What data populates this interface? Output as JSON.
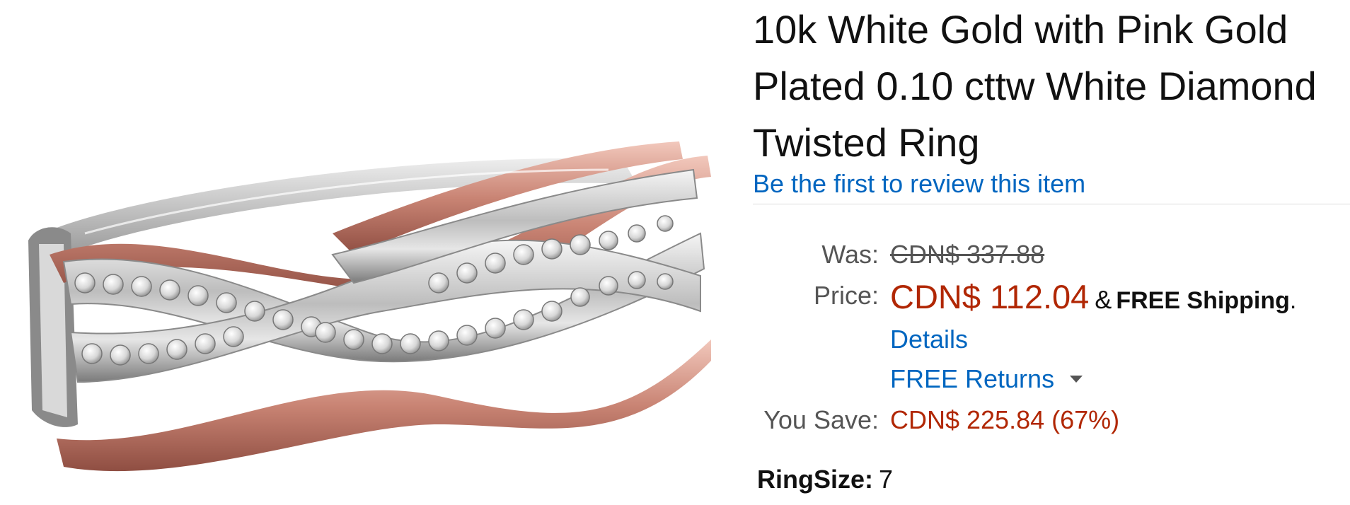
{
  "product": {
    "title": "10k White Gold with Pink Gold Plated 0.10 cttw White Diamond Twisted Ring",
    "review_link": "Be the first to review this item",
    "image_name": "ring-product-image"
  },
  "pricing": {
    "was_label": "Was:",
    "was_value": "CDN$ 337.88",
    "price_label": "Price:",
    "price_value": "CDN$ 112.04",
    "amp": "&",
    "free_shipping": "FREE Shipping",
    "period": ".",
    "details_link": "Details",
    "free_returns": "FREE Returns",
    "save_label": "You Save:",
    "save_value": "CDN$ 225.84 (67%)"
  },
  "variation": {
    "ringsize_label": "RingSize:",
    "ringsize_value": "7"
  },
  "colors": {
    "link": "#0066c0",
    "price": "#b12704",
    "rose_gold": "#c98474",
    "white_gold": "#d8d8d8"
  },
  "icons": {
    "returns_dropdown": "chevron-down-icon"
  }
}
